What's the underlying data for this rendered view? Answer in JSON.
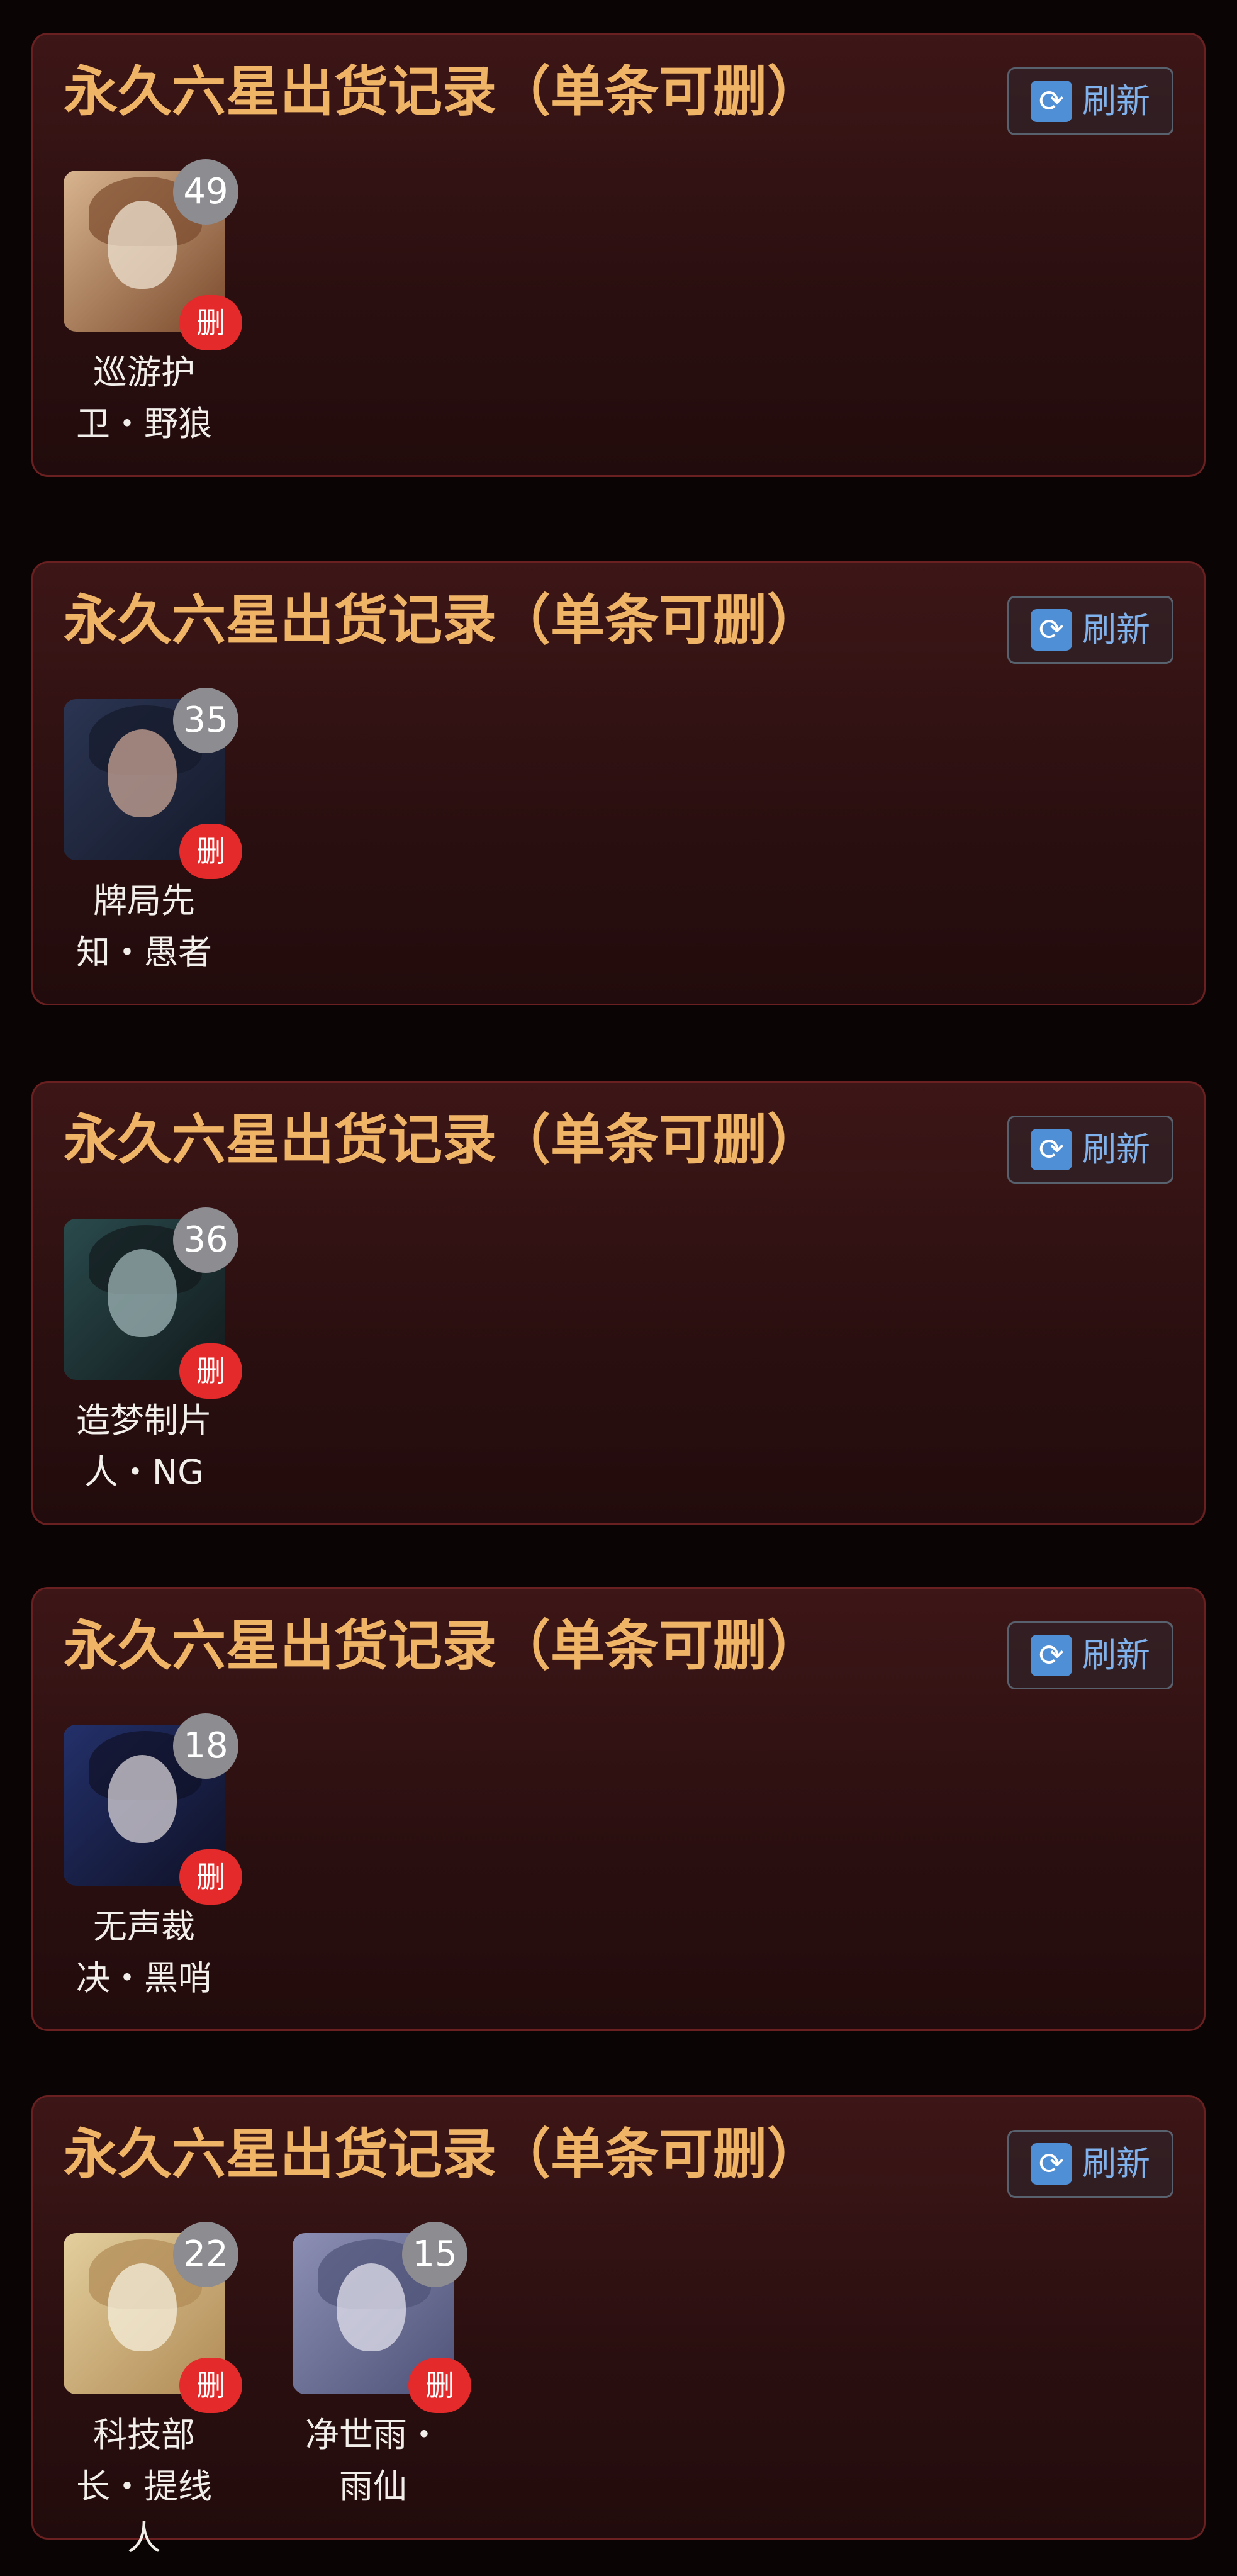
{
  "cards": [
    {
      "title": "永久六星出货记录（单条可删）",
      "refresh_label": "刷新",
      "items": [
        {
          "name": "巡游护卫・野狼",
          "count": "49",
          "delete_label": "删",
          "colors": [
            "#d8b48f",
            "#7a4a2c",
            "#efe3d2"
          ]
        }
      ]
    },
    {
      "title": "永久六星出货记录（单条可删）",
      "refresh_label": "刷新",
      "items": [
        {
          "name": "牌局先知・愚者",
          "count": "35",
          "delete_label": "删",
          "colors": [
            "#2b3552",
            "#151a2b",
            "#caa595"
          ]
        }
      ]
    },
    {
      "title": "永久六星出货记录（单条可删）",
      "refresh_label": "刷新",
      "items": [
        {
          "name": "造梦制片人・NG",
          "count": "36",
          "delete_label": "删",
          "colors": [
            "#2a4a4c",
            "#121a1c",
            "#9fb5b7"
          ]
        }
      ]
    },
    {
      "title": "永久六星出货记录（单条可删）",
      "refresh_label": "刷新",
      "items": [
        {
          "name": "无声裁决・黑哨",
          "count": "18",
          "delete_label": "删",
          "colors": [
            "#23306a",
            "#0f1126",
            "#d9d3d8"
          ]
        }
      ]
    },
    {
      "title": "永久六星出货记录（单条可删）",
      "refresh_label": "刷新",
      "items": [
        {
          "name": "科技部长・提线人",
          "count": "22",
          "delete_label": "删",
          "colors": [
            "#e3cf9d",
            "#b08a55",
            "#f6efdc"
          ]
        },
        {
          "name": "净世雨・雨仙",
          "count": "15",
          "delete_label": "删",
          "colors": [
            "#8d90b4",
            "#4e5278",
            "#e3e1ee"
          ]
        }
      ]
    }
  ]
}
